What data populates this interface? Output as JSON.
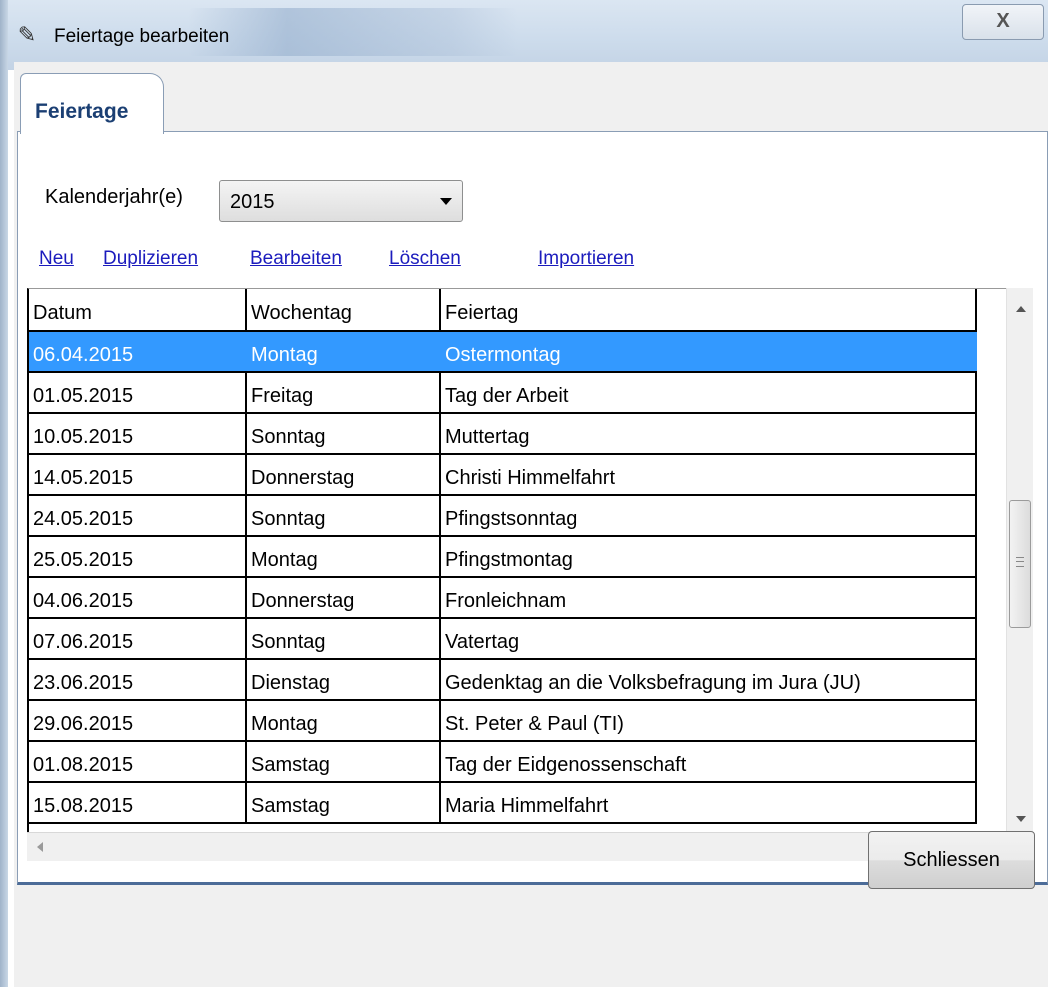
{
  "window": {
    "title": "Feiertage bearbeiten",
    "close_glyph": "X"
  },
  "tabs": [
    {
      "label": "Feiertage",
      "active": true
    }
  ],
  "year_filter": {
    "label": "Kalenderjahr(e)",
    "value": "2015"
  },
  "actions": {
    "new": "Neu",
    "duplicate": "Duplizieren",
    "edit": "Bearbeiten",
    "delete": "Löschen",
    "import": "Importieren"
  },
  "table": {
    "columns": [
      "Datum",
      "Wochentag",
      "Feiertag"
    ],
    "rows": [
      [
        "06.04.2015",
        "Montag",
        "Ostermontag"
      ],
      [
        "01.05.2015",
        "Freitag",
        "Tag der Arbeit"
      ],
      [
        "10.05.2015",
        "Sonntag",
        "Muttertag"
      ],
      [
        "14.05.2015",
        "Donnerstag",
        "Christi Himmelfahrt"
      ],
      [
        "24.05.2015",
        "Sonntag",
        "Pfingstsonntag"
      ],
      [
        "25.05.2015",
        "Montag",
        "Pfingstmontag"
      ],
      [
        "04.06.2015",
        "Donnerstag",
        "Fronleichnam"
      ],
      [
        "07.06.2015",
        "Sonntag",
        "Vatertag"
      ],
      [
        "23.06.2015",
        "Dienstag",
        "Gedenktag an die Volksbefragung im Jura (JU)"
      ],
      [
        "29.06.2015",
        "Montag",
        "St. Peter & Paul (TI)"
      ],
      [
        "01.08.2015",
        "Samstag",
        "Tag der Eidgenossenschaft"
      ],
      [
        "15.08.2015",
        "Samstag",
        "Maria Himmelfahrt"
      ]
    ],
    "selected_row": 0
  },
  "footer": {
    "close_label": "Schliessen"
  },
  "colors": {
    "selection": "#3399ff",
    "link": "#1b1bbd",
    "tab_text": "#1b3f73"
  },
  "icons": [
    "app-icon",
    "close-icon",
    "dropdown-arrow-icon",
    "scroll-up-icon",
    "scroll-down-icon",
    "scroll-left-icon",
    "scroll-right-icon"
  ]
}
